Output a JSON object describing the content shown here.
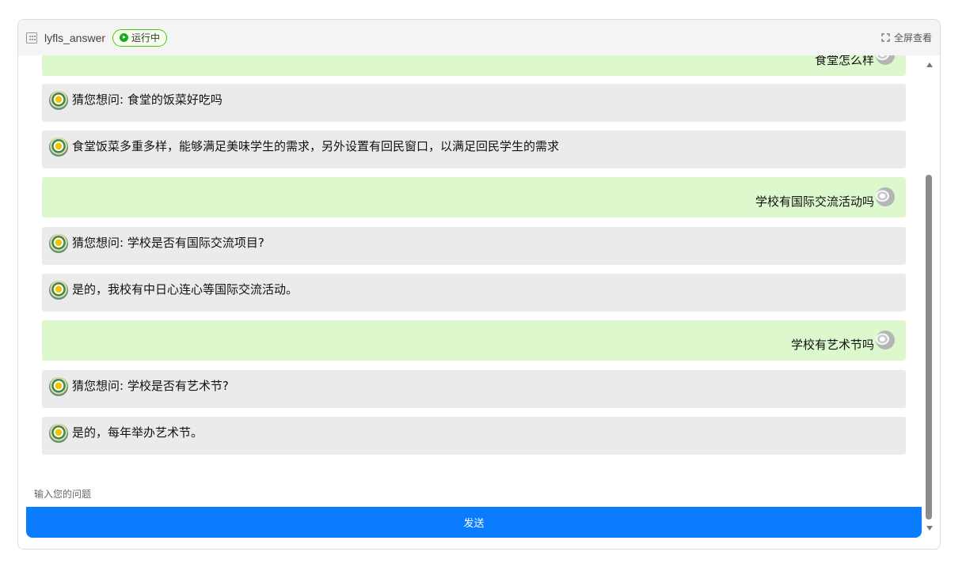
{
  "header": {
    "app_title": "lyfls_answer",
    "status": "运行中",
    "fullscreen_label": "全屏查看"
  },
  "messages": [
    {
      "role": "user",
      "text": "食堂怎么样"
    },
    {
      "role": "bot",
      "text": "猜您想问: 食堂的饭菜好吃吗"
    },
    {
      "role": "bot",
      "text": "食堂饭菜多重多样，能够满足美味学生的需求，另外设置有回民窗口，以满足回民学生的需求"
    },
    {
      "role": "user",
      "text": "学校有国际交流活动吗"
    },
    {
      "role": "bot",
      "text": "猜您想问: 学校是否有国际交流项目?"
    },
    {
      "role": "bot",
      "text": "是的，我校有中日心连心等国际交流活动。"
    },
    {
      "role": "user",
      "text": "学校有艺术节吗"
    },
    {
      "role": "bot",
      "text": "猜您想问: 学校是否有艺术节?"
    },
    {
      "role": "bot",
      "text": "是的，每年举办艺术节。"
    }
  ],
  "input": {
    "placeholder": "输入您的问题",
    "value": ""
  },
  "send_label": "发送",
  "colors": {
    "user_bubble": "#dcf8cc",
    "bot_bubble": "#ebebeb",
    "send_button": "#0a7cff",
    "status_green": "#52c41a"
  }
}
